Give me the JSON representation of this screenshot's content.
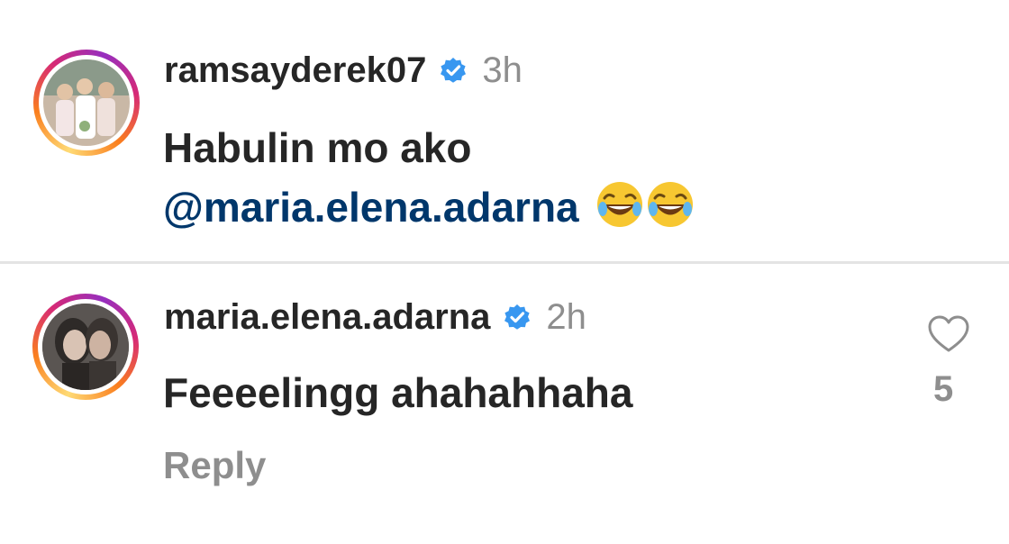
{
  "comments": [
    {
      "username": "ramsayderek07",
      "verified": true,
      "time": "3h",
      "text_line1": "Habulin mo ako",
      "mention": "@maria.elena.adarna",
      "emojis": [
        "rolling-on-floor-laughing-emoji",
        "rolling-on-floor-laughing-emoji"
      ]
    },
    {
      "username": "maria.elena.adarna",
      "verified": true,
      "time": "2h",
      "text": "Feeeelingg ahahahhaha",
      "likes": "5",
      "reply_label": "Reply"
    }
  ],
  "colors": {
    "text": "#262626",
    "muted": "#8e8e8e",
    "mention": "#00376b",
    "verified": "#3897f0"
  },
  "icons": [
    "verified-badge-icon",
    "heart-icon",
    "laughing-emoji-icon"
  ]
}
